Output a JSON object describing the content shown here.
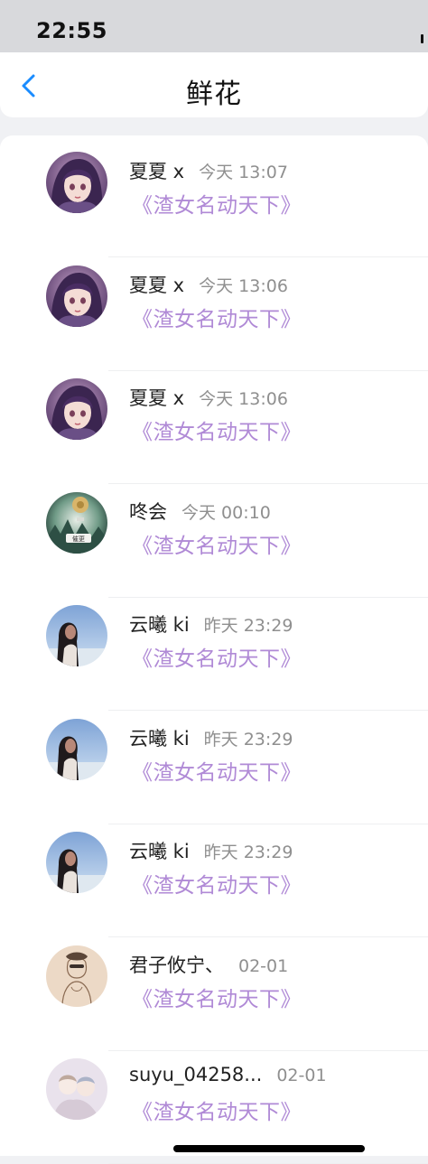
{
  "status_bar": {
    "time": "22:55"
  },
  "header": {
    "title": "鲜花"
  },
  "records": [
    {
      "user": "夏夏 x",
      "time": "今天 13:07",
      "book": "《渣女名动天下》",
      "avatar": "anime-girl"
    },
    {
      "user": "夏夏 x",
      "time": "今天 13:06",
      "book": "《渣女名动天下》",
      "avatar": "anime-girl"
    },
    {
      "user": "夏夏 x",
      "time": "今天 13:06",
      "book": "《渣女名动天下》",
      "avatar": "anime-girl"
    },
    {
      "user": "咚会",
      "time": "今天 00:10",
      "book": "《渣女名动天下》",
      "avatar": "forest-badge",
      "avatar_text": "催更"
    },
    {
      "user": "云曦 ki",
      "time": "昨天 23:29",
      "book": "《渣女名动天下》",
      "avatar": "woman-sky"
    },
    {
      "user": "云曦 ki",
      "time": "昨天 23:29",
      "book": "《渣女名动天下》",
      "avatar": "woman-sky"
    },
    {
      "user": "云曦 ki",
      "time": "昨天 23:29",
      "book": "《渣女名动天下》",
      "avatar": "woman-sky"
    },
    {
      "user": "君子攸宁、",
      "time": "02-01",
      "book": "《渣女名动天下》",
      "avatar": "sketch-girl"
    },
    {
      "user": "suyu_04258...",
      "time": "02-01",
      "book": "《渣女名动天下》",
      "avatar": "pastel-couple"
    }
  ]
}
